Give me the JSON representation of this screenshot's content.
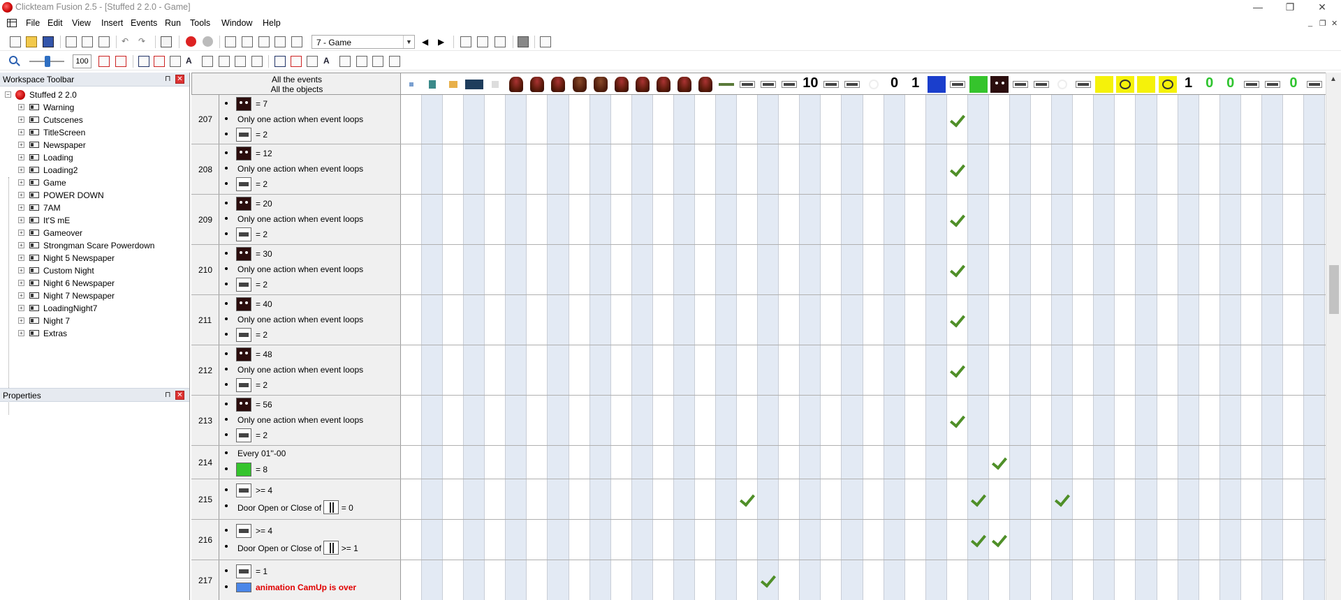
{
  "window": {
    "title": "Clickteam Fusion 2.5 - [Stuffed 2 2.0 - Game]",
    "min": "—",
    "max": "❐",
    "close": "✕"
  },
  "menu": {
    "items": [
      "File",
      "Edit",
      "View",
      "Insert",
      "Events",
      "Run",
      "Tools",
      "Window",
      "Help"
    ],
    "mdi": {
      "min": "_",
      "restore": "❐",
      "close": "✕"
    }
  },
  "toolbar": {
    "frame_select": "7 - Game",
    "zoom_value": "100"
  },
  "workspace": {
    "title": "Workspace Toolbar",
    "root": "Stuffed 2 2.0",
    "frames": [
      "Warning",
      "Cutscenes",
      "TitleScreen",
      "Newspaper",
      "Loading",
      "Loading2",
      "Game",
      "POWER DOWN",
      "7AM",
      "It'S mE",
      "Gameover",
      "Strongman Scare Powerdown",
      "Night 5 Newspaper",
      "Custom Night",
      "Night 6 Newspaper",
      "Night 7 Newspaper",
      "LoadingNight7",
      "Night 7",
      "Extras"
    ]
  },
  "properties": {
    "title": "Properties"
  },
  "event_editor": {
    "header_line1": "All the events",
    "header_line2": "All the objects",
    "header_numbers": [
      "10",
      "0",
      "1",
      "1",
      "0",
      "0",
      "0"
    ],
    "events": [
      {
        "num": "207",
        "conditions": [
          {
            "icon": "dark",
            "text": "= 7"
          },
          {
            "icon": "none",
            "text": "Only one action when event loops"
          },
          {
            "icon": "counter",
            "text": "= 2"
          }
        ]
      },
      {
        "num": "208",
        "conditions": [
          {
            "icon": "dark",
            "text": "= 12"
          },
          {
            "icon": "none",
            "text": "Only one action when event loops"
          },
          {
            "icon": "counter",
            "text": "= 2"
          }
        ]
      },
      {
        "num": "209",
        "conditions": [
          {
            "icon": "dark",
            "text": "= 20"
          },
          {
            "icon": "none",
            "text": "Only one action when event loops"
          },
          {
            "icon": "counter",
            "text": "= 2"
          }
        ]
      },
      {
        "num": "210",
        "conditions": [
          {
            "icon": "dark",
            "text": "= 30"
          },
          {
            "icon": "none",
            "text": "Only one action when event loops"
          },
          {
            "icon": "counter",
            "text": "= 2"
          }
        ]
      },
      {
        "num": "211",
        "conditions": [
          {
            "icon": "dark",
            "text": "= 40"
          },
          {
            "icon": "none",
            "text": "Only one action when event loops"
          },
          {
            "icon": "counter",
            "text": "= 2"
          }
        ]
      },
      {
        "num": "212",
        "conditions": [
          {
            "icon": "dark",
            "text": "= 48"
          },
          {
            "icon": "none",
            "text": "Only one action when event loops"
          },
          {
            "icon": "counter",
            "text": "= 2"
          }
        ]
      },
      {
        "num": "213",
        "conditions": [
          {
            "icon": "dark",
            "text": "= 56"
          },
          {
            "icon": "none",
            "text": "Only one action when event loops"
          },
          {
            "icon": "counter",
            "text": "= 2"
          }
        ]
      },
      {
        "num": "214",
        "conditions": [
          {
            "icon": "none",
            "text": "Every 01''-00"
          },
          {
            "icon": "green",
            "text": "= 8"
          }
        ]
      },
      {
        "num": "215",
        "conditions": [
          {
            "icon": "counter",
            "text": ">= 4"
          },
          {
            "icon": "none",
            "text": "Door Open or Close of",
            "tail": "= 0"
          }
        ]
      },
      {
        "num": "216",
        "conditions": [
          {
            "icon": "counter",
            "text": ">= 4"
          },
          {
            "icon": "none",
            "text": "Door Open or Close of",
            "tail": ">= 1"
          }
        ]
      },
      {
        "num": "217",
        "conditions": [
          {
            "icon": "counter",
            "text": "= 1"
          },
          {
            "icon": "blue",
            "text": "animation CamUp is over",
            "red": true
          }
        ]
      }
    ]
  }
}
